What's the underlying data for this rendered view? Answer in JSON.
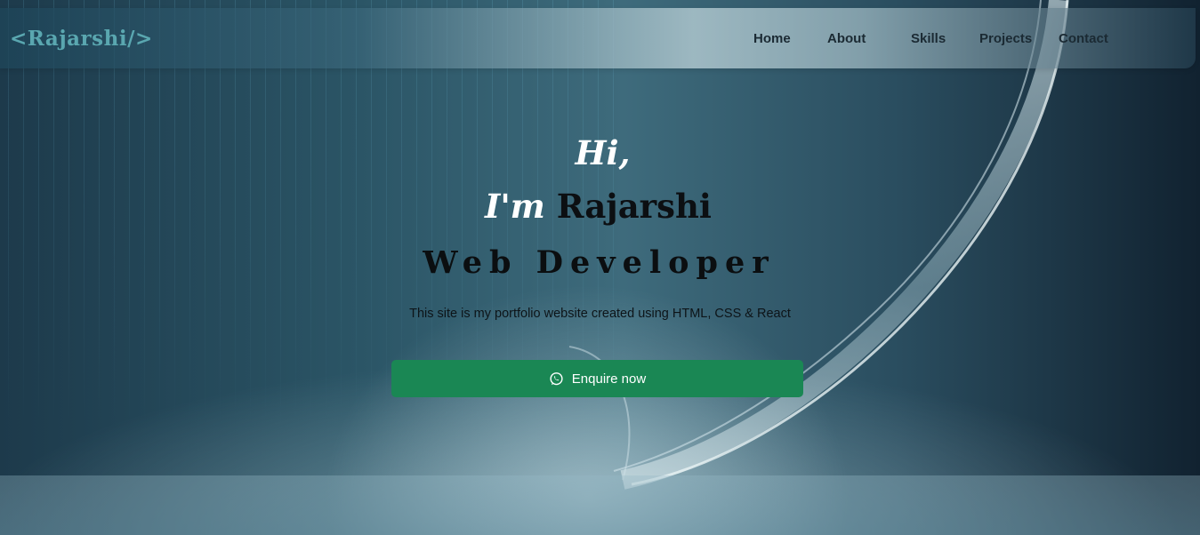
{
  "brand": {
    "logo_text": "<Rajarshi/>"
  },
  "nav": {
    "items": [
      {
        "label": "Home"
      },
      {
        "label": "About"
      },
      {
        "label": "Skills"
      },
      {
        "label": "Projects"
      },
      {
        "label": "Contact"
      }
    ]
  },
  "hero": {
    "greeting": "Hi,",
    "intro_prefix": "I'm",
    "name": "Rajarshi",
    "role": "Web Developer",
    "description": "This site is my portfolio website created using HTML, CSS & React",
    "cta_label": "Enquire now",
    "cta_icon": "whatsapp-icon"
  },
  "colors": {
    "accent_green": "#1a8754",
    "logo_teal": "#5aa7b0"
  }
}
